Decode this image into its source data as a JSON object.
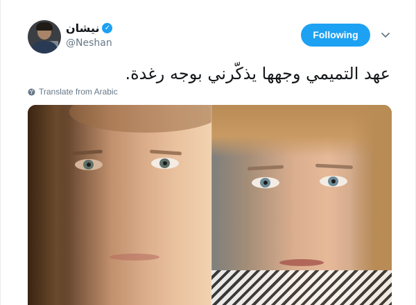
{
  "tweet": {
    "author_name": "نيشان",
    "verified_glyph": "✓",
    "handle": "@Neshan",
    "follow_button_label": "Following",
    "text": "عهد التميمي وجهها يذكّرني بوجه رغدة.",
    "translate_label": "Translate from Arabic",
    "accent_color": "#1da1f2"
  },
  "icons": {
    "verified": "verified-badge-icon",
    "caret": "chevron-down-icon",
    "globe": "globe-icon"
  }
}
